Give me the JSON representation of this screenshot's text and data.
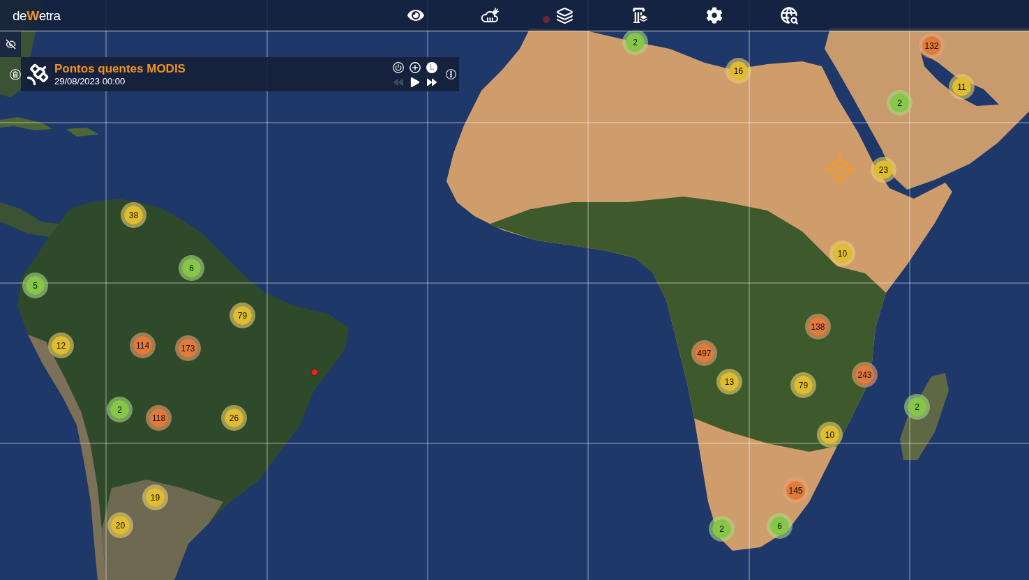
{
  "top_bar": {
    "logo": [
      {
        "text": "de",
        "accent": false
      },
      {
        "text": "W",
        "accent": true
      },
      {
        "text": "etra",
        "accent": false
      }
    ]
  },
  "layer_panel": {
    "title": "Pontos quentes MODIS",
    "date": "29/08/2023 00:00",
    "legend_button": "L",
    "playback": [
      {
        "kind": "rewind",
        "disabled": true
      },
      {
        "kind": "play",
        "disabled": false
      },
      {
        "kind": "forward",
        "disabled": false
      }
    ]
  },
  "map": {
    "clusters": [
      {
        "count": "2",
        "color": "#86c74a"
      },
      {
        "count": "132",
        "color": "#e27a3a"
      },
      {
        "count": "16",
        "color": "#e0bc30"
      },
      {
        "count": "11",
        "color": "#e0bc30"
      },
      {
        "count": "2",
        "color": "#86c74a"
      },
      {
        "count": "23",
        "color": "#e0bc30"
      },
      {
        "count": "38",
        "color": "#e0bc30"
      },
      {
        "count": "10",
        "color": "#e0bc30"
      },
      {
        "count": "6",
        "color": "#86c74a"
      },
      {
        "count": "5",
        "color": "#86c74a"
      },
      {
        "count": "79",
        "color": "#e0bc30"
      },
      {
        "count": "138",
        "color": "#e27a3a"
      },
      {
        "count": "12",
        "color": "#e0bc30"
      },
      {
        "count": "114",
        "color": "#e27a3a"
      },
      {
        "count": "173",
        "color": "#e27a3a"
      },
      {
        "count": "497",
        "color": "#e27a3a"
      },
      {
        "count": "243",
        "color": "#e27a3a"
      },
      {
        "count": "13",
        "color": "#e0bc30"
      },
      {
        "count": "79",
        "color": "#e0bc30"
      },
      {
        "count": "2",
        "color": "#86c74a"
      },
      {
        "count": "2",
        "color": "#86c74a"
      },
      {
        "count": "118",
        "color": "#e27a3a"
      },
      {
        "count": "26",
        "color": "#e0bc30"
      },
      {
        "count": "10",
        "color": "#e0bc30"
      },
      {
        "count": "145",
        "color": "#e27a3a"
      },
      {
        "count": "19",
        "color": "#e0bc30"
      },
      {
        "count": "20",
        "color": "#e0bc30"
      },
      {
        "count": "6",
        "color": "#86c74a"
      },
      {
        "count": "2",
        "color": "#86c74a"
      }
    ]
  }
}
